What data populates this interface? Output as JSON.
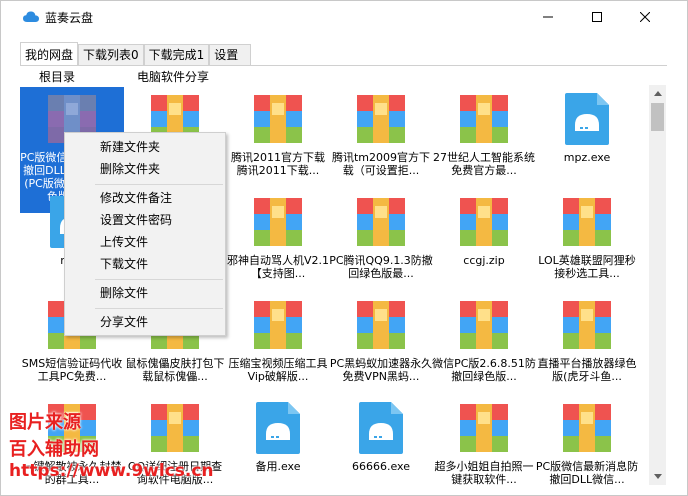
{
  "window": {
    "title": "蓝奏云盘",
    "minimize_glyph": "—",
    "maximize_glyph": "☐",
    "close_glyph": "✕"
  },
  "tabs": [
    {
      "label": "我的网盘",
      "active": true
    },
    {
      "label": "下载列表0",
      "active": false
    },
    {
      "label": "下载完成1",
      "active": false
    },
    {
      "label": "设置",
      "active": false
    }
  ],
  "breadcrumbs": {
    "root": "根目录",
    "folder": "电脑软件分享"
  },
  "files": [
    {
      "name": "PC版微信2.6.8.51防撤回DLL微信电脑版(PC版微信多开）绿色版2019",
      "icon": "zip-selected",
      "selected": true
    },
    {
      "name": "",
      "icon": "zip"
    },
    {
      "name": "腾讯2011官方下载腾讯2011下载...",
      "icon": "zip"
    },
    {
      "name": "腾讯tm2009官方下载（可设置拒...",
      "icon": "zip"
    },
    {
      "name": "27世纪人工智能系统免费官方最...",
      "icon": "zip"
    },
    {
      "name": "mpz.exe",
      "icon": "exe"
    },
    {
      "name": "mpz",
      "icon": "exe"
    },
    {
      "name": "",
      "icon": "zip"
    },
    {
      "name": "邪神自动骂人机V2.1【支持图...",
      "icon": "zip"
    },
    {
      "name": "PC腾讯QQ9.1.3防撤回绿色版最...",
      "icon": "zip"
    },
    {
      "name": "ccgj.zip",
      "icon": "zip"
    },
    {
      "name": "LOL英雄联盟阿狸秒接秒选工具...",
      "icon": "zip"
    },
    {
      "name": "SMS短信验证码代收工具PC免费...",
      "icon": "zip"
    },
    {
      "name": "鼠标傀儡皮肤打包下载鼠标傀儡...",
      "icon": "zip"
    },
    {
      "name": "压缩宝视频压缩工具Vip破解版...",
      "icon": "zip"
    },
    {
      "name": "PC黑蚂蚁加速器永久免费VPN黑蚂...",
      "icon": "zip"
    },
    {
      "name": "微信PC版2.6.8.51防撤回绿色版...",
      "icon": "zip"
    },
    {
      "name": "直播平台播放器绿色版(虎牙斗鱼...",
      "icon": "zip"
    },
    {
      "name": "一键解散被永久封禁的群工具...",
      "icon": "zip"
    },
    {
      "name": "QQ详细注册日期查询软件电脑版...",
      "icon": "zip"
    },
    {
      "name": "备用.exe",
      "icon": "exe"
    },
    {
      "name": "66666.exe",
      "icon": "exe"
    },
    {
      "name": "超多小姐姐自拍照一键获取软件...",
      "icon": "zip"
    },
    {
      "name": "PC版微信最新消息防撤回DLL微信...",
      "icon": "zip"
    }
  ],
  "context_menu": {
    "items": [
      {
        "label": "新建文件夹"
      },
      {
        "label": "删除文件夹"
      },
      {
        "label": "修改文件备注"
      },
      {
        "label": "设置文件密码"
      },
      {
        "label": "上传文件"
      },
      {
        "label": "下载文件"
      },
      {
        "label": "删除文件"
      },
      {
        "label": "分享文件"
      }
    ]
  },
  "watermark": {
    "line1": "图片来源",
    "line2": "百入辅助网",
    "line3": "https://www.9wlcs.cn"
  },
  "colors": {
    "selection": "#1e6fd6",
    "zip_orange": "#f5a623",
    "zip_red": "#ef5350",
    "zip_green": "#8bc34a",
    "zip_blue": "#42a5f5",
    "zip_purple": "#8e6bb5",
    "exe_blue": "#3aa5e8",
    "watermark": "#e82020"
  }
}
